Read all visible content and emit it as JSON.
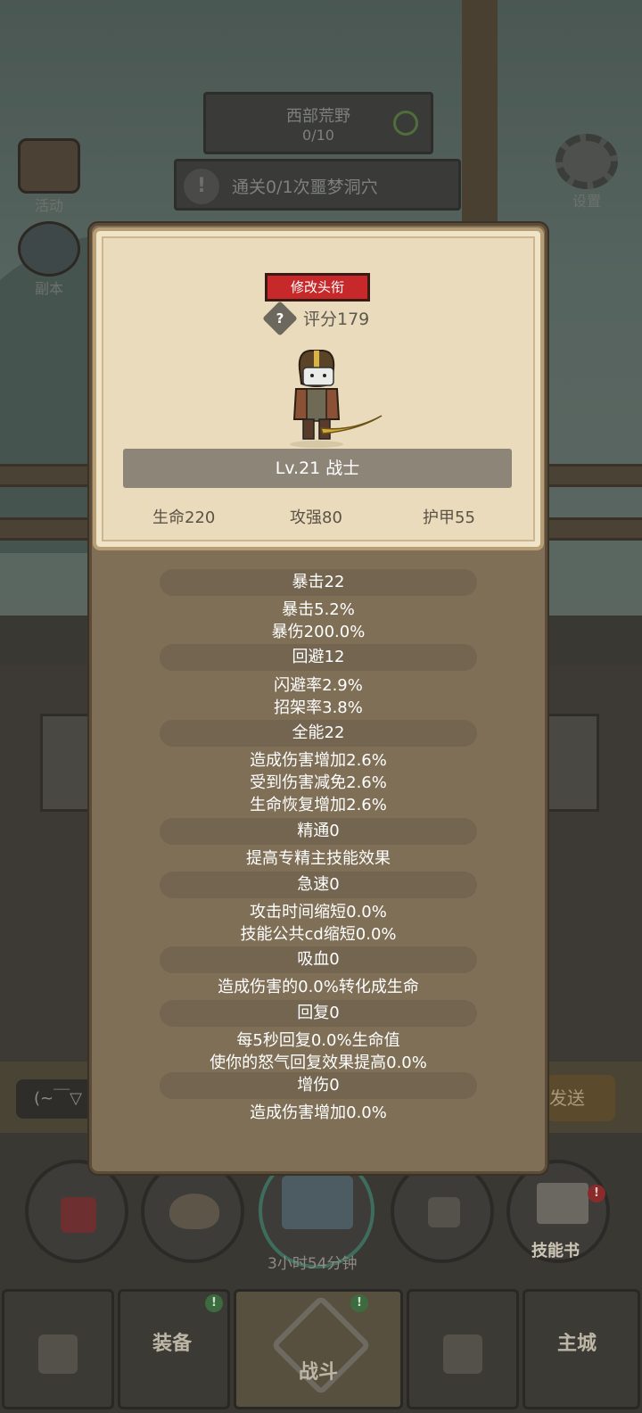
{
  "background": {
    "quest_title": "西部荒野",
    "quest_progress": "0/10",
    "dungeon_task": "通关0/1次噩梦洞穴",
    "left_buttons": [
      "活动",
      "副本"
    ],
    "settings_label": "设置",
    "chat_placeholder": "(~￣▽",
    "send_label": "发送",
    "timer": "3小时54分钟",
    "skill_book_label": "技能书",
    "nav": {
      "equipment": "装备",
      "battle": "战斗",
      "main_city": "主城"
    }
  },
  "profile": {
    "change_title_label": "修改头衔",
    "score": "评分179",
    "level_class": "Lv.21 战士",
    "stats": {
      "hp": "生命220",
      "attack": "攻强80",
      "armor": "护甲55"
    }
  },
  "attributes": [
    {
      "header": "暴击22",
      "lines": [
        "暴击5.2%",
        "暴伤200.0%"
      ]
    },
    {
      "header": "回避12",
      "lines": [
        "闪避率2.9%",
        "招架率3.8%"
      ]
    },
    {
      "header": "全能22",
      "lines": [
        "造成伤害增加2.6%",
        "受到伤害减免2.6%",
        "生命恢复增加2.6%"
      ]
    },
    {
      "header": "精通0",
      "lines": [
        "提高专精主技能效果"
      ]
    },
    {
      "header": "急速0",
      "lines": [
        "攻击时间缩短0.0%",
        "技能公共cd缩短0.0%"
      ]
    },
    {
      "header": "吸血0",
      "lines": [
        "造成伤害的0.0%转化成生命"
      ]
    },
    {
      "header": "回复0",
      "lines": [
        "每5秒回复0.0%生命值",
        "使你的怒气回复效果提高0.0%"
      ]
    },
    {
      "header": "增伤0",
      "lines": [
        "造成伤害增加0.0%"
      ]
    }
  ],
  "colors": {
    "title_button": "#c7292b",
    "panel": "#7f6f56",
    "card": "#e9dbbb",
    "badge_green": "#4caf50",
    "badge_red": "#e53935"
  }
}
